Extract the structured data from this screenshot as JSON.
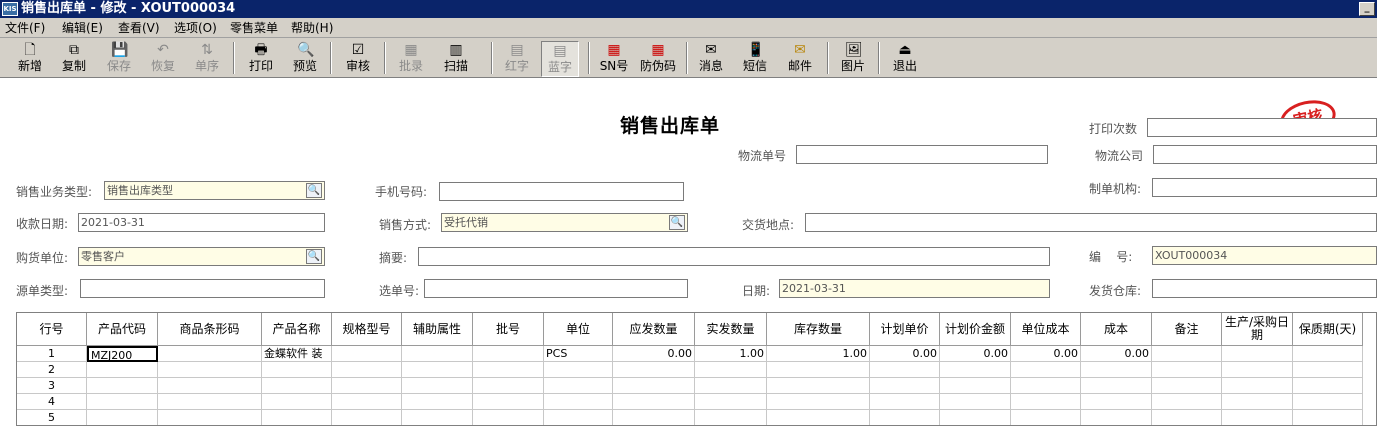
{
  "window": {
    "title": "销售出库单 - 修改 - XOUT000034",
    "app_icon": "KIS",
    "min_glyph": "_"
  },
  "menu": [
    {
      "label": "文件(F)"
    },
    {
      "label": "编辑(E)"
    },
    {
      "label": "查看(V)"
    },
    {
      "label": "选项(O)"
    },
    {
      "label": "零售菜单"
    },
    {
      "label": "帮助(H)"
    }
  ],
  "toolbar": [
    {
      "label": "新增",
      "icon": "new-document-icon",
      "glyph": "🗋",
      "enabled": true
    },
    {
      "label": "复制",
      "icon": "copy-icon",
      "glyph": "⧉",
      "enabled": true
    },
    {
      "label": "保存",
      "icon": "save-icon",
      "glyph": "💾",
      "enabled": false
    },
    {
      "label": "恢复",
      "icon": "undo-icon",
      "glyph": "↶",
      "enabled": false
    },
    {
      "label": "单序",
      "icon": "sequence-icon",
      "glyph": "⇅",
      "enabled": false
    },
    {
      "label": "打印",
      "icon": "printer-icon",
      "glyph": "🖶",
      "enabled": true
    },
    {
      "label": "预览",
      "icon": "preview-icon",
      "glyph": "🔍",
      "enabled": true
    },
    {
      "label": "审核",
      "icon": "audit-icon",
      "glyph": "☑",
      "enabled": true
    },
    {
      "label": "批录",
      "icon": "batch-entry-icon",
      "glyph": "▦",
      "enabled": false
    },
    {
      "label": "扫描",
      "icon": "barcode-scan-icon",
      "glyph": "▥",
      "enabled": true
    },
    {
      "label": "红字",
      "icon": "red-invoice-icon",
      "glyph": "▤",
      "enabled": false
    },
    {
      "label": "蓝字",
      "icon": "blue-invoice-icon",
      "glyph": "▤",
      "enabled": false,
      "pressed": true
    },
    {
      "label": "SN号",
      "icon": "serial-number-icon",
      "glyph": "▦",
      "enabled": true
    },
    {
      "label": "防伪码",
      "icon": "anti-counterfeit-icon",
      "glyph": "▦",
      "enabled": true
    },
    {
      "label": "消息",
      "icon": "message-icon",
      "glyph": "✉",
      "enabled": true
    },
    {
      "label": "短信",
      "icon": "sms-icon",
      "glyph": "📱",
      "enabled": true
    },
    {
      "label": "邮件",
      "icon": "mail-icon",
      "glyph": "✉",
      "enabled": true
    },
    {
      "label": "图片",
      "icon": "picture-icon",
      "glyph": "🖼",
      "enabled": true
    },
    {
      "label": "退出",
      "icon": "exit-icon",
      "glyph": "⏏",
      "enabled": true
    }
  ],
  "form": {
    "heading": "销售出库单",
    "stamp": "审核",
    "fields": {
      "print_count": {
        "label": "打印次数",
        "value": ""
      },
      "logistics_no": {
        "label": "物流单号",
        "value": ""
      },
      "logistics_co": {
        "label": "物流公司",
        "value": ""
      },
      "biz_type": {
        "label": "销售业务类型:",
        "value": "销售出库类型",
        "lookup": true
      },
      "mobile": {
        "label": "手机号码:",
        "value": ""
      },
      "maker_org": {
        "label": "制单机构:",
        "value": ""
      },
      "receipt_date": {
        "label": "收款日期:",
        "value": "2021-03-31"
      },
      "sale_method": {
        "label": "销售方式:",
        "value": "受托代销",
        "lookup": true
      },
      "delivery_place": {
        "label": "交货地点:",
        "value": ""
      },
      "buyer": {
        "label": "购货单位:",
        "value": "零售客户",
        "lookup": true
      },
      "summary": {
        "label": "摘要:",
        "value": ""
      },
      "doc_no": {
        "label": "编    号:",
        "value": "XOUT000034"
      },
      "source_type": {
        "label": "源单类型:",
        "value": ""
      },
      "select_no": {
        "label": "选单号:",
        "value": ""
      },
      "date": {
        "label": "日期:",
        "value": "2021-03-31"
      },
      "warehouse": {
        "label": "发货仓库:",
        "value": ""
      }
    }
  },
  "grid": {
    "columns": [
      "行号",
      "产品代码",
      "商品条形码",
      "产品名称",
      "规格型号",
      "辅助属性",
      "批号",
      "单位",
      "应发数量",
      "实发数量",
      "库存数量",
      "计划单价",
      "计划价金额",
      "单位成本",
      "成本",
      "备注",
      "生产/采购日期",
      "保质期(天)"
    ],
    "rows": [
      [
        "1",
        "MZJ200",
        "",
        "金蝶软件 装",
        "",
        "",
        "",
        "PCS",
        "0.00",
        "1.00",
        "1.00",
        "0.00",
        "0.00",
        "0.00",
        "0.00",
        "",
        "",
        ""
      ],
      [
        "2",
        "",
        "",
        "",
        "",
        "",
        "",
        "",
        "",
        "",
        "",
        "",
        "",
        "",
        "",
        "",
        "",
        ""
      ],
      [
        "3",
        "",
        "",
        "",
        "",
        "",
        "",
        "",
        "",
        "",
        "",
        "",
        "",
        "",
        "",
        "",
        "",
        ""
      ],
      [
        "4",
        "",
        "",
        "",
        "",
        "",
        "",
        "",
        "",
        "",
        "",
        "",
        "",
        "",
        "",
        "",
        "",
        ""
      ],
      [
        "5",
        "",
        "",
        "",
        "",
        "",
        "",
        "",
        "",
        "",
        "",
        "",
        "",
        "",
        "",
        "",
        "",
        ""
      ]
    ]
  },
  "colors": {
    "titlebar": "#0a246a",
    "chrome": "#d4d0c8",
    "required_field": "#fffde6",
    "stamp": "#d82020"
  }
}
